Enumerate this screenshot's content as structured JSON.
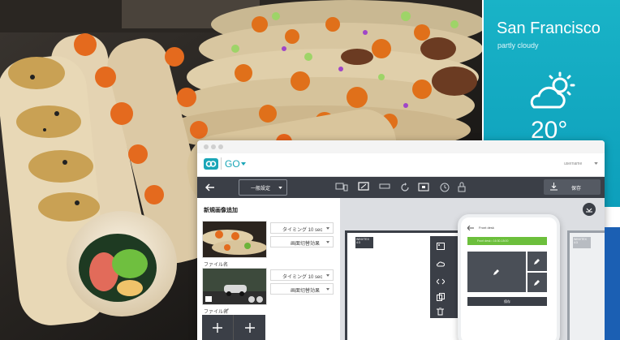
{
  "weather": {
    "city": "San Francisco",
    "condition": "partly cloudy",
    "temperature": "20°",
    "icon": "partly-cloudy-icon"
  },
  "app": {
    "logo_text": "GO",
    "username": "username",
    "toolbar": {
      "mode_select": "一般設定",
      "save_label": "保存"
    },
    "panel": {
      "title": "新規画像追加",
      "items": [
        {
          "timing": "タイミング 10 sec",
          "effect": "画面切替効果",
          "file_label": "ファイル名"
        },
        {
          "timing": "タイミング 10 sec",
          "effect": "画面切替効果",
          "file_label": "ファイル名"
        }
      ]
    },
    "canvas": {
      "slide_label": "WINVTEX\n4:3",
      "right_label": "WINVTEX\n4:3"
    },
    "phone": {
      "back_label": "Front desk",
      "green_bar": "Front desk  •  16:30-18:00",
      "button_label": "保存"
    }
  },
  "colors": {
    "weather_bg": "#13aac2",
    "toolbar_bg": "#3b3f47",
    "accent_green": "#6cbf3c",
    "logo_teal": "#1aa6b7"
  }
}
